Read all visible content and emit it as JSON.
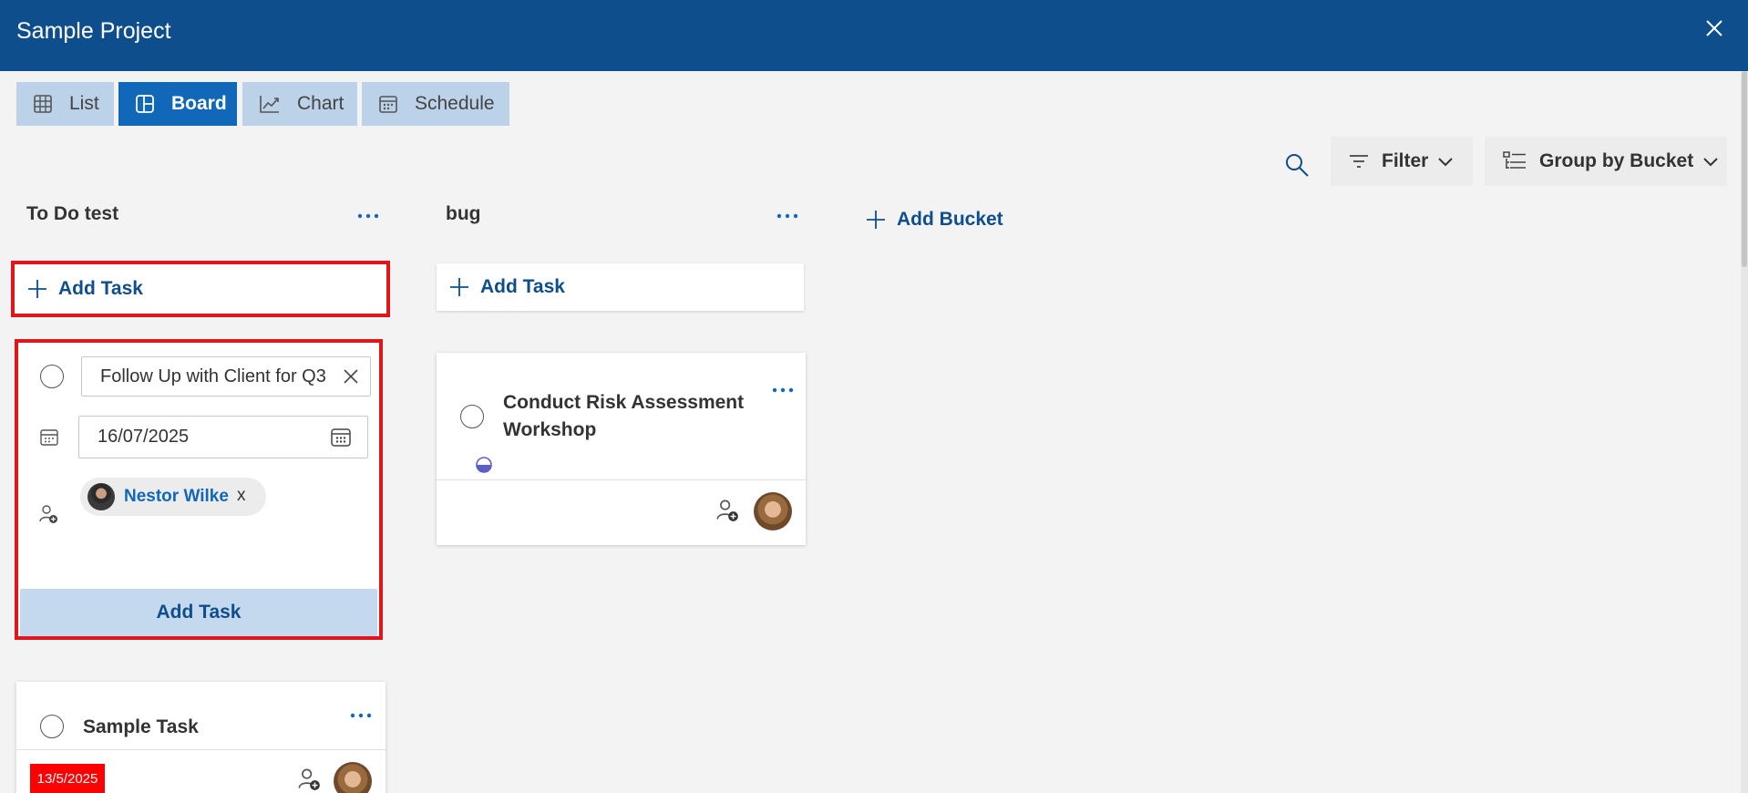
{
  "window": {
    "title": "Sample Project",
    "close_icon": "close-icon"
  },
  "tabs": [
    {
      "label": "List",
      "icon": "grid-icon",
      "active": false
    },
    {
      "label": "Board",
      "icon": "board-icon",
      "active": true
    },
    {
      "label": "Chart",
      "icon": "chart-icon",
      "active": false
    },
    {
      "label": "Schedule",
      "icon": "calendar-icon",
      "active": false
    }
  ],
  "toolbar": {
    "search_icon": "search-icon",
    "filter_label": "Filter",
    "group_label": "Group by Bucket"
  },
  "buckets": [
    {
      "title": "To Do test",
      "add_task_label": "Add Task",
      "new_task_form": {
        "name_value": "Follow Up with Client for Q3",
        "due_date": "16/07/2025",
        "assignee": "Nestor Wilke",
        "remove_label": "x",
        "submit_label": "Add Task"
      },
      "tasks": [
        {
          "title": "Sample Task",
          "due": "13/5/2025"
        }
      ]
    },
    {
      "title": "bug",
      "add_task_label": "Add Task",
      "tasks": [
        {
          "title": "Conduct Risk Assessment Workshop",
          "progress": "half-complete"
        }
      ]
    }
  ],
  "add_bucket_label": "Add Bucket",
  "colors": {
    "header": "#0f4e8c",
    "active_tab": "#1168b8",
    "inactive_tab": "#bcd2e8",
    "highlight": "#e0161b",
    "overdue": "#ff0000",
    "progress": "#5b5fc7"
  }
}
